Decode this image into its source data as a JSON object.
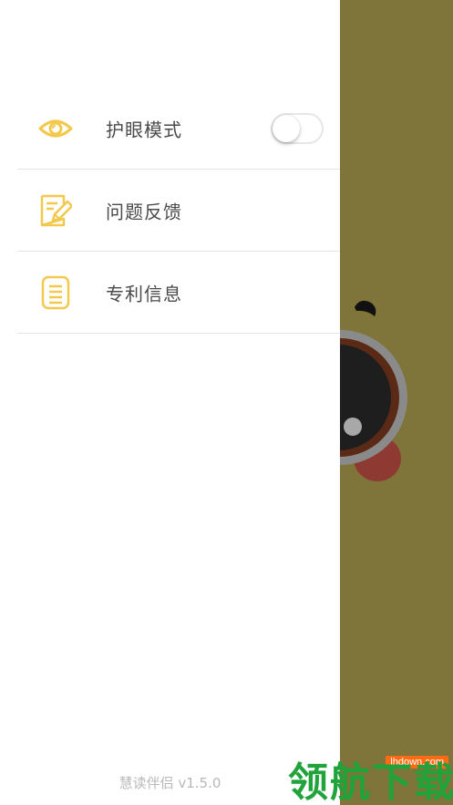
{
  "drawer": {
    "menu_items": [
      {
        "label": "护眼模式",
        "icon": "eye-icon",
        "has_toggle": true,
        "toggle_on": false
      },
      {
        "label": "问题反馈",
        "icon": "feedback-edit-icon"
      },
      {
        "label": "专利信息",
        "icon": "document-list-icon"
      }
    ],
    "version": "慧读伴侣 v1.5.0"
  },
  "colors": {
    "accent": "#f2c94c",
    "background_panel": "#7f743a",
    "label": "#4a4a4a",
    "divider": "#e4e4e4",
    "version_text": "#b8b8b8"
  },
  "watermark": {
    "badge": "lhdown.com",
    "text": "领航下载"
  }
}
